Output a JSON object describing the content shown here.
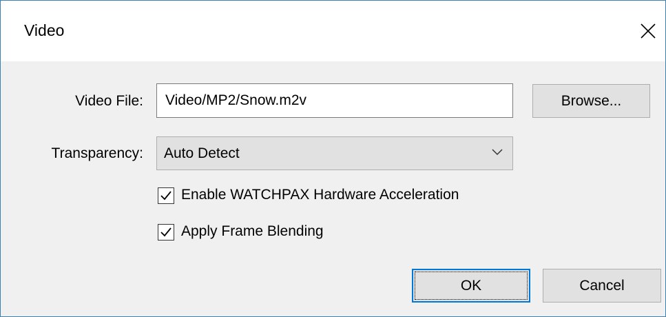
{
  "dialog": {
    "title": "Video",
    "close_icon": "close-icon"
  },
  "video_file": {
    "label": "Video File:",
    "value": "Video/MP2/Snow.m2v",
    "browse_label": "Browse..."
  },
  "transparency": {
    "label": "Transparency:",
    "selected": "Auto Detect",
    "dropdown_icon": "chevron-down-icon"
  },
  "options": [
    {
      "label": "Enable WATCHPAX Hardware Acceleration",
      "checked": true
    },
    {
      "label": "Apply Frame Blending",
      "checked": true
    }
  ],
  "footer": {
    "ok_label": "OK",
    "cancel_label": "Cancel"
  },
  "colors": {
    "window_border": "#3c7fb1",
    "focus_accent": "#0078d7",
    "button_face": "#e1e1e1"
  }
}
